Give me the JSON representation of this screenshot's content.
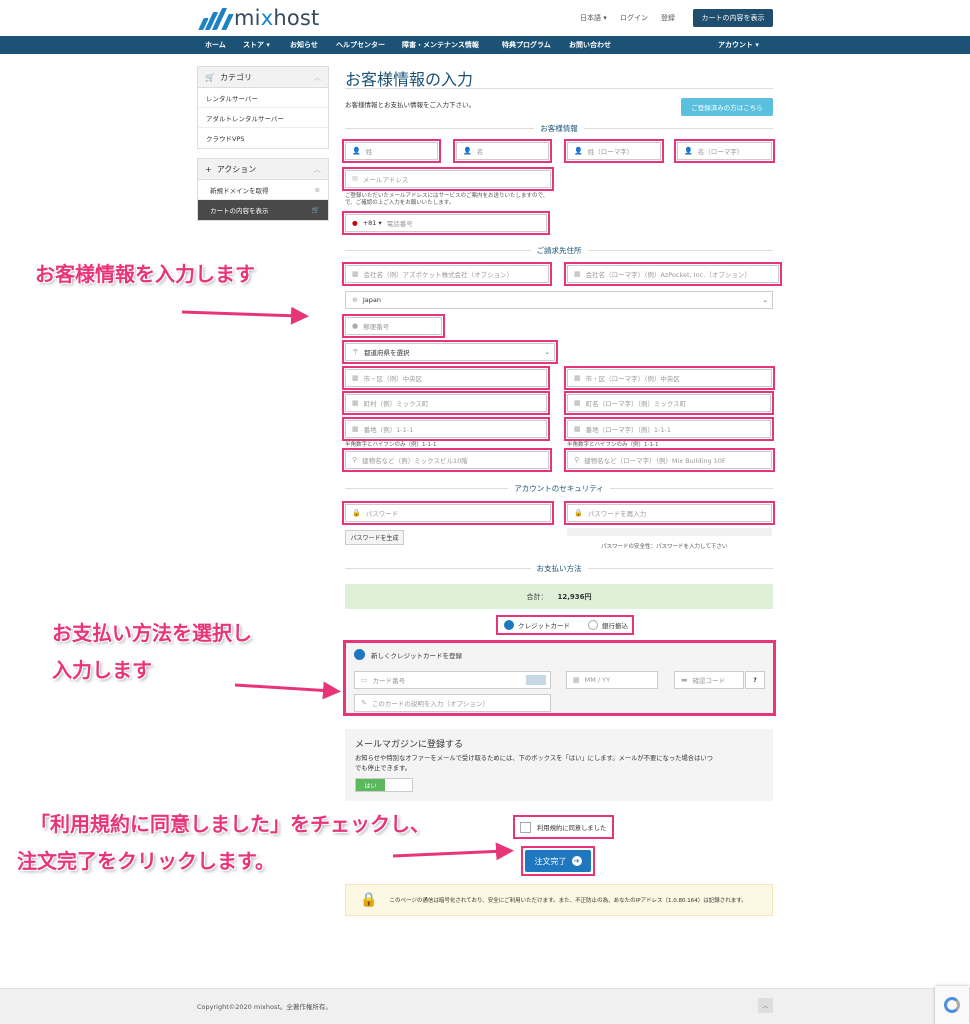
{
  "header": {
    "logo_text_1": "mi",
    "logo_text_2": "x",
    "logo_text_3": "host",
    "language": "日本語 ▾",
    "login": "ログイン",
    "register": "登録",
    "view_cart": "カートの内容を表示"
  },
  "nav": {
    "items": [
      "ホーム",
      "ストア ▾",
      "お知らせ",
      "ヘルプセンター",
      "障害・メンテナンス情報",
      "特典プログラム",
      "お問い合わせ"
    ],
    "account": "アカウント ▾"
  },
  "sidebar": {
    "categories_title": "カテゴリ",
    "categories": [
      "レンタルサーバー",
      "アダルトレンタルサーバー",
      "クラウドVPS"
    ],
    "actions_title": "アクション",
    "actions": [
      "新規ドメインを取得",
      "カートの内容を表示"
    ]
  },
  "main": {
    "title": "お客様情報の入力",
    "intro": "お客様情報とお支払い情報をご入力下さい。",
    "registered_button": "ご登録済みの方はこちら",
    "customer_section": "お客様情報",
    "fields": {
      "last_name": "姓",
      "first_name": "名",
      "last_name_roman": "姓（ローマ字）",
      "first_name_roman": "名（ローマ字）",
      "email": "メールアドレス",
      "email_note": "ご登録いただいたメールアドレスにはサービスのご案内をお送りいたしますので、",
      "email_note2": "で、ご確認の上ご入力をお願いいたします。",
      "phone_code": "+81 ▾",
      "phone": "電話番号"
    },
    "billing_section": "ご請求先住所",
    "billing": {
      "company": "会社名（例）アズポケット株式会社（オプション）",
      "company_roman": "会社名（ローマ字）（例）AzPocket, Inc.（オプション）",
      "country": "Japan",
      "zip": "郵便番号",
      "prefecture": "都道府県を選択",
      "city": "市・区（例）中央区",
      "city_roman": "市・区（ローマ字）（例）中央区",
      "town": "町村（例）ミックス町",
      "town_roman": "町名（ローマ字）（例）ミックス町",
      "address": "番地（例）1-1-1",
      "address_roman": "番地（ローマ字）（例）1-1-1",
      "address_note": "半角数字とハイフンのみ（例）1-1-1",
      "address_note_roman": "半角数字とハイフンのみ（例）1-1-1",
      "building": "建物名など（例）ミックスビル10階",
      "building_roman": "建物名など（ローマ字）（例）Mix Building 10F"
    },
    "security_section": "アカウントのセキュリティ",
    "security": {
      "password": "パスワード",
      "password_confirm": "パスワードを再入力",
      "generate": "パスワードを生成",
      "strength": "パスワードの安全性：パスワードを入力して下さい"
    },
    "payment_section": "お支払い方法",
    "total_label": "合計：",
    "total_value": "12,936円",
    "payment_credit": "クレジットカード",
    "payment_bank": "銀行振込",
    "card": {
      "new_card": "新しくクレジットカードを登録",
      "number": "カード番号",
      "expiry": "MM / YY",
      "cvc": "確認コード",
      "help": "?",
      "description": "このカードの説明を入力（オプション）"
    },
    "mailmag": {
      "title": "メールマガジンに登録する",
      "text": "お知らせや特別なオファーをメールで受け取るためには、下のボックスを「はい」にします。メールが不要になった場合はいつ",
      "text2": "でも停止できます。",
      "toggle_on": "はい"
    },
    "terms": "利用規約に同意しました",
    "submit": "注文完了",
    "notice": "このページの通信は暗号化されており、安全にご利用いただけます。また、不正防止の為、あなたのIPアドレス（1.0.80.164）は記録されます。"
  },
  "footer": {
    "copyright": "Copyright©2020 mixhost。全著作権所有。",
    "up": "︿"
  },
  "annotations": {
    "a1": "お客様情報を入力します",
    "a2_line1": "お支払い方法を選択し",
    "a2_line2": "入力します",
    "a3_line1": "「利用規約に同意しました」をチェックし、",
    "a3_line2": "注文完了をクリックします。"
  },
  "colors": {
    "accent": "#e8357a",
    "nav": "#1b5276",
    "primary": "#1f77c0"
  }
}
